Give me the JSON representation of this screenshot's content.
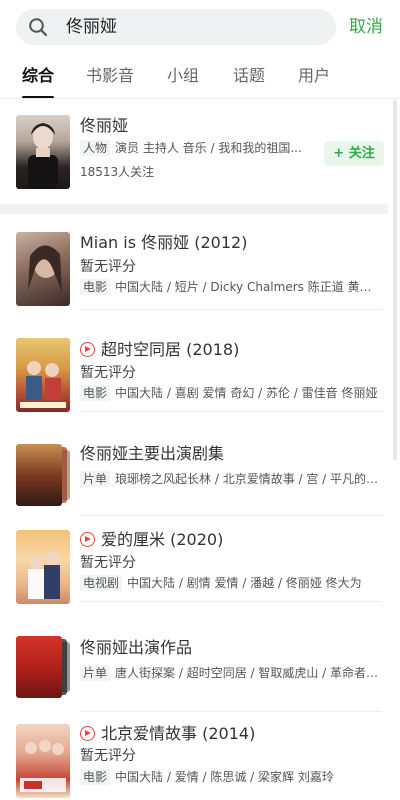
{
  "search": {
    "query": "佟丽娅",
    "cancel_label": "取消"
  },
  "tabs": [
    {
      "label": "综合",
      "active": true
    },
    {
      "label": "书影音",
      "active": false
    },
    {
      "label": "小组",
      "active": false
    },
    {
      "label": "话题",
      "active": false
    },
    {
      "label": "用户",
      "active": false
    }
  ],
  "person": {
    "name": "佟丽娅",
    "tag": "人物",
    "description": "演员 主持人 音乐 / 我和我的祖国...",
    "followers": "18513人关注",
    "follow_label": "+ 关注"
  },
  "results": [
    {
      "title": "Mian is 佟丽娅",
      "year": "(2012)",
      "playable": false,
      "rating": "暂无评分",
      "tag": "电影",
      "meta": "中国大陆 / 短片 / Dicky Chalmers 陈正道 黄秋...",
      "cover": "single"
    },
    {
      "title": "超时空同居",
      "year": "(2018)",
      "playable": true,
      "rating": "暂无评分",
      "tag": "电影",
      "meta": "中国大陆 / 喜剧 爱情 奇幻 / 苏伦 / 雷佳音 佟丽娅",
      "cover": "single"
    },
    {
      "title": "佟丽娅主要出演剧集",
      "year": "",
      "playable": false,
      "rating": "",
      "tag": "片单",
      "meta": "琅琊榜之风起长林 / 北京爱情故事 / 宫 / 平凡的世...",
      "cover": "stack"
    },
    {
      "title": "爱的厘米",
      "year": "(2020)",
      "playable": true,
      "rating": "暂无评分",
      "tag": "电视剧",
      "meta": "中国大陆 / 剧情 爱情 / 潘越 / 佟丽娅 佟大为",
      "cover": "single"
    },
    {
      "title": "佟丽娅出演作品",
      "year": "",
      "playable": false,
      "rating": "",
      "tag": "片单",
      "meta": "唐人街探案 / 超时空同居 / 智取威虎山 / 革命者 / 鼠...",
      "cover": "stack"
    },
    {
      "title": "北京爱情故事",
      "year": "(2014)",
      "playable": true,
      "rating": "暂无评分",
      "tag": "电影",
      "meta": "中国大陆 / 爱情 / 陈思诚 / 梁家辉 刘嘉玲",
      "cover": "single"
    }
  ],
  "colors": {
    "accent": "#2dab4b",
    "play": "#e0463d"
  }
}
